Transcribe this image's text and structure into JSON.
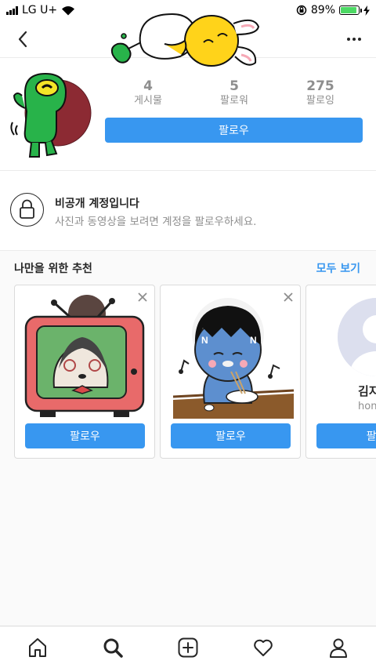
{
  "status": {
    "carrier": "LG U+",
    "battery": "89%",
    "battery_level": 0.89,
    "icons": [
      "signal-icon",
      "wifi-icon",
      "orientation-lock-icon",
      "battery-icon",
      "charging-icon"
    ]
  },
  "header": {
    "back_icon": "chevron-left-icon",
    "more_icon": "more-dots-icon"
  },
  "profile": {
    "stats": [
      {
        "value": "4",
        "label": "게시물"
      },
      {
        "value": "5",
        "label": "팔로워"
      },
      {
        "value": "275",
        "label": "팔로잉"
      }
    ],
    "follow_label": "팔로우"
  },
  "private_account": {
    "icon": "lock-icon",
    "title": "비공개 계정입니다",
    "subtitle": "사진과 동영상을 보려면 계정을 팔로우하세요."
  },
  "suggestions": {
    "title": "나만을 위한 추천",
    "see_all": "모두 보기",
    "cards": [
      {
        "follow_label": "팔로우"
      },
      {
        "follow_label": "팔로우"
      },
      {
        "name": "김지",
        "sub": "hon",
        "follow_label": "팔로"
      }
    ]
  },
  "bottom_nav": {
    "items": [
      "home-icon",
      "search-icon",
      "new-post-icon",
      "activity-heart-icon",
      "profile-icon"
    ]
  },
  "colors": {
    "accent": "#3897f0",
    "battery": "#4cd964"
  }
}
